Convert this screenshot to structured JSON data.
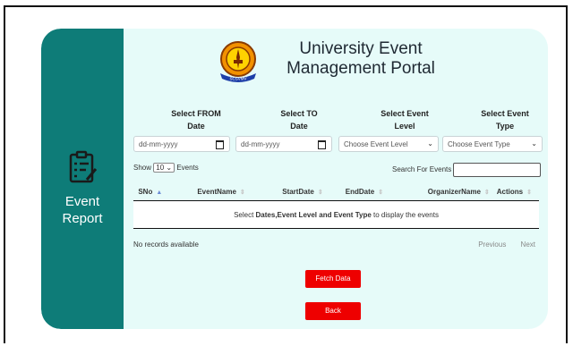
{
  "sidebar": {
    "label_line1": "Event",
    "label_line2": "Report",
    "icon": "clipboard-list-icon"
  },
  "header": {
    "title_line1": "University Event",
    "title_line2": "Management Portal",
    "logo": "university-seal-logo",
    "logo_text": "SCSVMV"
  },
  "filters": [
    {
      "line1": "Select FROM",
      "line2": "Date",
      "placeholder": "dd-mm-yyyy"
    },
    {
      "line1": "Select TO",
      "line2": "Date",
      "placeholder": "dd-mm-yyyy"
    },
    {
      "line1": "Select Event",
      "line2": "Level",
      "placeholder": "Choose Event Level"
    },
    {
      "line1": "Select Event",
      "line2": "Type",
      "placeholder": "Choose Event Type"
    }
  ],
  "table_controls": {
    "show_label": "Show",
    "show_value": "10",
    "entries_label": "Events",
    "search_label": "Search For Events"
  },
  "table": {
    "columns": [
      "SNo",
      "EventName",
      "StartDate",
      "EndDate",
      "OrganizerName",
      "Actions"
    ],
    "empty_prefix": "Select ",
    "empty_bold1": "Dates,Event Level",
    "empty_mid": " and ",
    "empty_bold2": "Event Type",
    "empty_suffix": " to display the events"
  },
  "footer": {
    "status": "No records available",
    "previous": "Previous",
    "next": "Next"
  },
  "buttons": {
    "fetch": "Fetch Data",
    "back": "Back"
  },
  "colors": {
    "sidebar": "#0e7c78",
    "card": "#e6fbf9",
    "button": "#ee0000"
  }
}
